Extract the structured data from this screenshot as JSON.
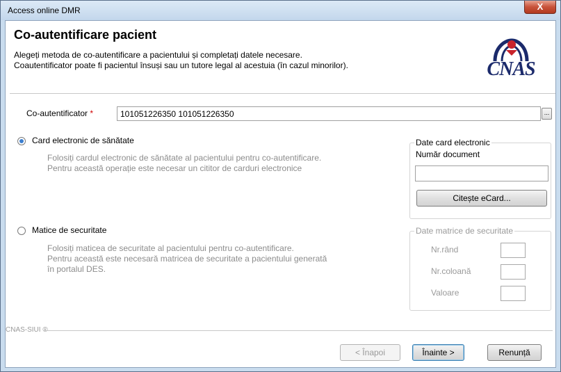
{
  "window": {
    "title": "Access online DMR",
    "close_label": "X"
  },
  "header": {
    "title": "Co-autentificare pacient",
    "line1": "Alegeți metoda de co-autentificare a pacientului și completați datele necesare.",
    "line2": "Coautentificator poate fi pacientul însuși sau un tutore legal al acestuia (în cazul minorilor).",
    "logo_text": "CNAS"
  },
  "coauth": {
    "label": "Co-autentificator",
    "required_mark": "*",
    "value": "101051226350 101051226350",
    "browse_label": "..."
  },
  "card_option": {
    "label": "Card electronic de sănătate",
    "selected": true,
    "desc1": "Folosiți cardul electronic de sănătate al pacientului pentru co-autentificare.",
    "desc2": "Pentru această operație este necesar un cititor de carduri electronice"
  },
  "card_group": {
    "legend": "Date card electronic",
    "doc_label": "Număr document",
    "doc_value": "",
    "read_button": "Citește eCard..."
  },
  "matrix_option": {
    "label": "Matice de securitate",
    "selected": false,
    "desc1": "Folosiți maticea de securitate al pacientului pentru co-autentificare.",
    "desc2": "Pentru această este necesară matricea de securitate a pacientului generată",
    "desc3": "în portalul DES."
  },
  "matrix_group": {
    "legend": "Date matrice de securitate",
    "row_label": "Nr.rând",
    "col_label": "Nr.coloană",
    "value_label": "Valoare"
  },
  "footer": {
    "brand": "CNAS-SIUI ®",
    "back_button": "< Înapoi",
    "next_button": "Înainte >",
    "cancel_button": "Renunță"
  }
}
